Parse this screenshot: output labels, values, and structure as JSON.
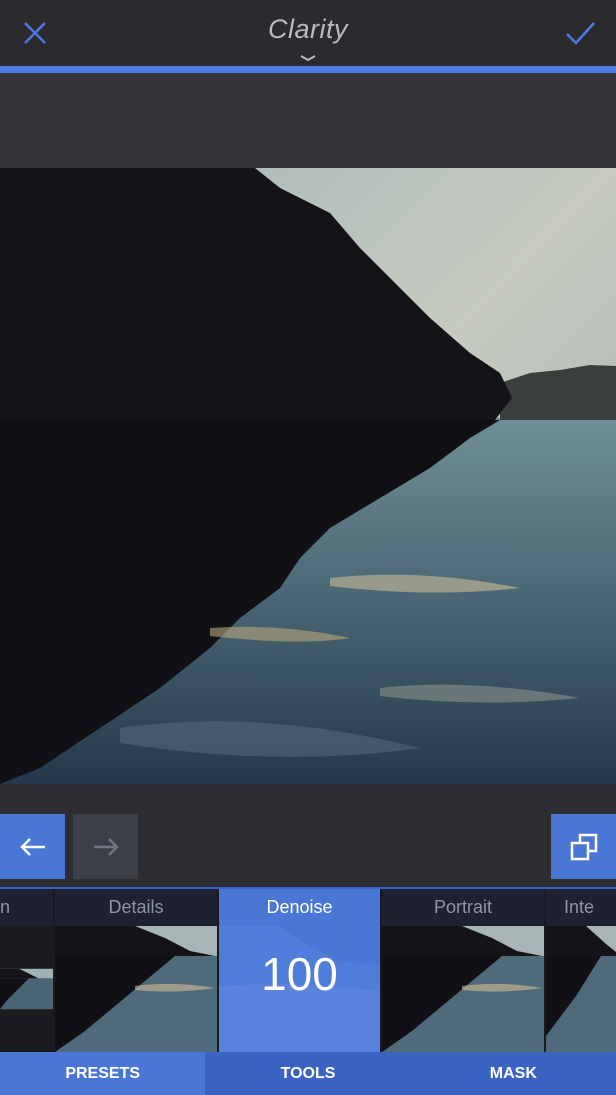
{
  "header": {
    "title": "Clarity",
    "close_icon": "close-icon",
    "confirm_icon": "checkmark-icon",
    "dropdown_icon": "chevron-down-icon"
  },
  "history": {
    "undo_icon": "arrow-left-icon",
    "redo_icon": "arrow-right-icon",
    "compare_icon": "compare-icon"
  },
  "presets": [
    {
      "label": "n",
      "active": false
    },
    {
      "label": "Details",
      "active": false
    },
    {
      "label": "Denoise",
      "active": true,
      "value": "100"
    },
    {
      "label": "Portrait",
      "active": false
    },
    {
      "label": "Inte",
      "active": false
    }
  ],
  "tabs": [
    {
      "label": "PRESETS"
    },
    {
      "label": "TOOLS"
    },
    {
      "label": "MASK"
    }
  ],
  "colors": {
    "accent": "#4a76d6",
    "accent_dark": "#3a63c2",
    "bar": "#2b2b2f"
  }
}
